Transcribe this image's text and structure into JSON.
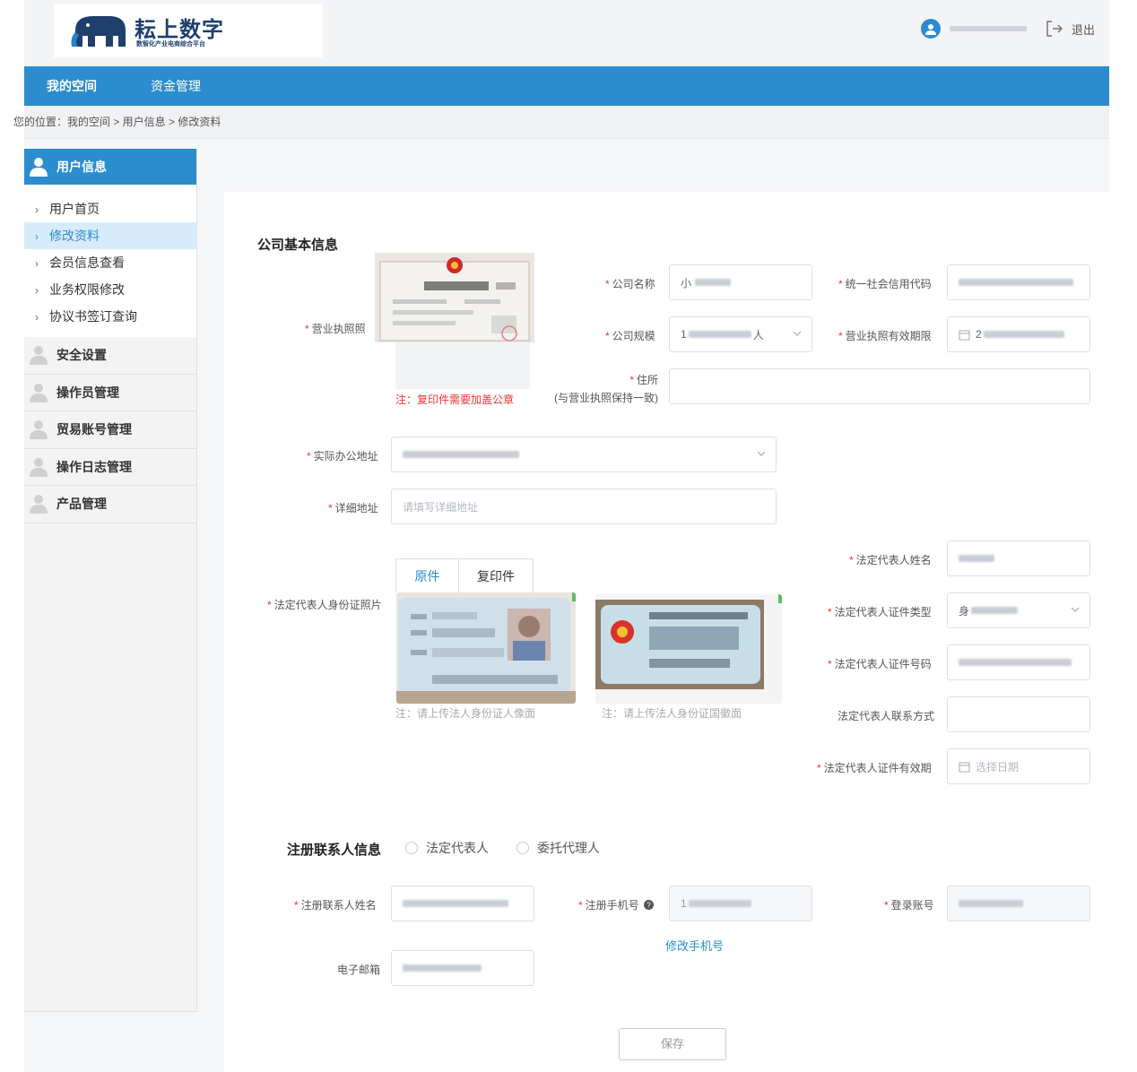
{
  "header": {
    "logo_title": "耘上数字",
    "logo_subtitle": "数智化产业电商综合平台",
    "logout_label": "退出"
  },
  "nav": {
    "items": [
      {
        "label": "我的空间",
        "active": true
      },
      {
        "label": "资金管理",
        "active": false
      }
    ]
  },
  "breadcrumb": {
    "text": "您的位置：我的空间 > 用户信息 > 修改资料"
  },
  "sidebar": {
    "header": "用户信息",
    "sub_items": [
      {
        "label": "用户首页",
        "active": false
      },
      {
        "label": "修改资料",
        "active": true
      },
      {
        "label": "会员信息查看",
        "active": false
      },
      {
        "label": "业务权限修改",
        "active": false
      },
      {
        "label": "协议书签订查询",
        "active": false
      }
    ],
    "groups": [
      "安全设置",
      "操作员管理",
      "贸易账号管理",
      "操作日志管理",
      "产品管理"
    ]
  },
  "company": {
    "section_title": "公司基本信息",
    "license_label": "营业执照照",
    "license_note": "注：复印件需要加盖公章",
    "name_label": "公司名称",
    "name_value_prefix": "小",
    "credit_code_label": "统一社会信用代码",
    "scale_label": "公司规模",
    "scale_value_prefix": "1",
    "scale_value_suffix": "人",
    "license_validity_label": "营业执照有效期限",
    "license_validity_prefix": "2",
    "residence_label": "住所",
    "residence_sub_label": "(与营业执照保持一致)",
    "office_address_label": "实际办公地址",
    "detail_address_label": "详细地址",
    "detail_address_placeholder": "请填写详细地址"
  },
  "legal": {
    "id_photo_label": "法定代表人身份证照片",
    "tab_original": "原件",
    "tab_copy": "复印件",
    "front_note": "注：请上传法人身份证人像面",
    "back_note": "注：请上传法人身份证国徽面",
    "name_label": "法定代表人姓名",
    "id_type_label": "法定代表人证件类型",
    "id_type_prefix": "身",
    "id_number_label": "法定代表人证件号码",
    "contact_label": "法定代表人联系方式",
    "id_validity_label": "法定代表人证件有效期",
    "id_validity_placeholder": "选择日期"
  },
  "contact": {
    "section_title": "注册联系人信息",
    "radio_legal": "法定代表人",
    "radio_agent": "委托代理人",
    "name_label": "注册联系人姓名",
    "phone_label": "注册手机号",
    "phone_prefix": "1",
    "account_label": "登录账号",
    "change_phone_link": "修改手机号",
    "email_label": "电子邮箱"
  },
  "actions": {
    "save_label": "保存"
  },
  "colors": {
    "primary": "#2b8cce",
    "required": "#e33333",
    "logo": "#1f3f6d"
  }
}
